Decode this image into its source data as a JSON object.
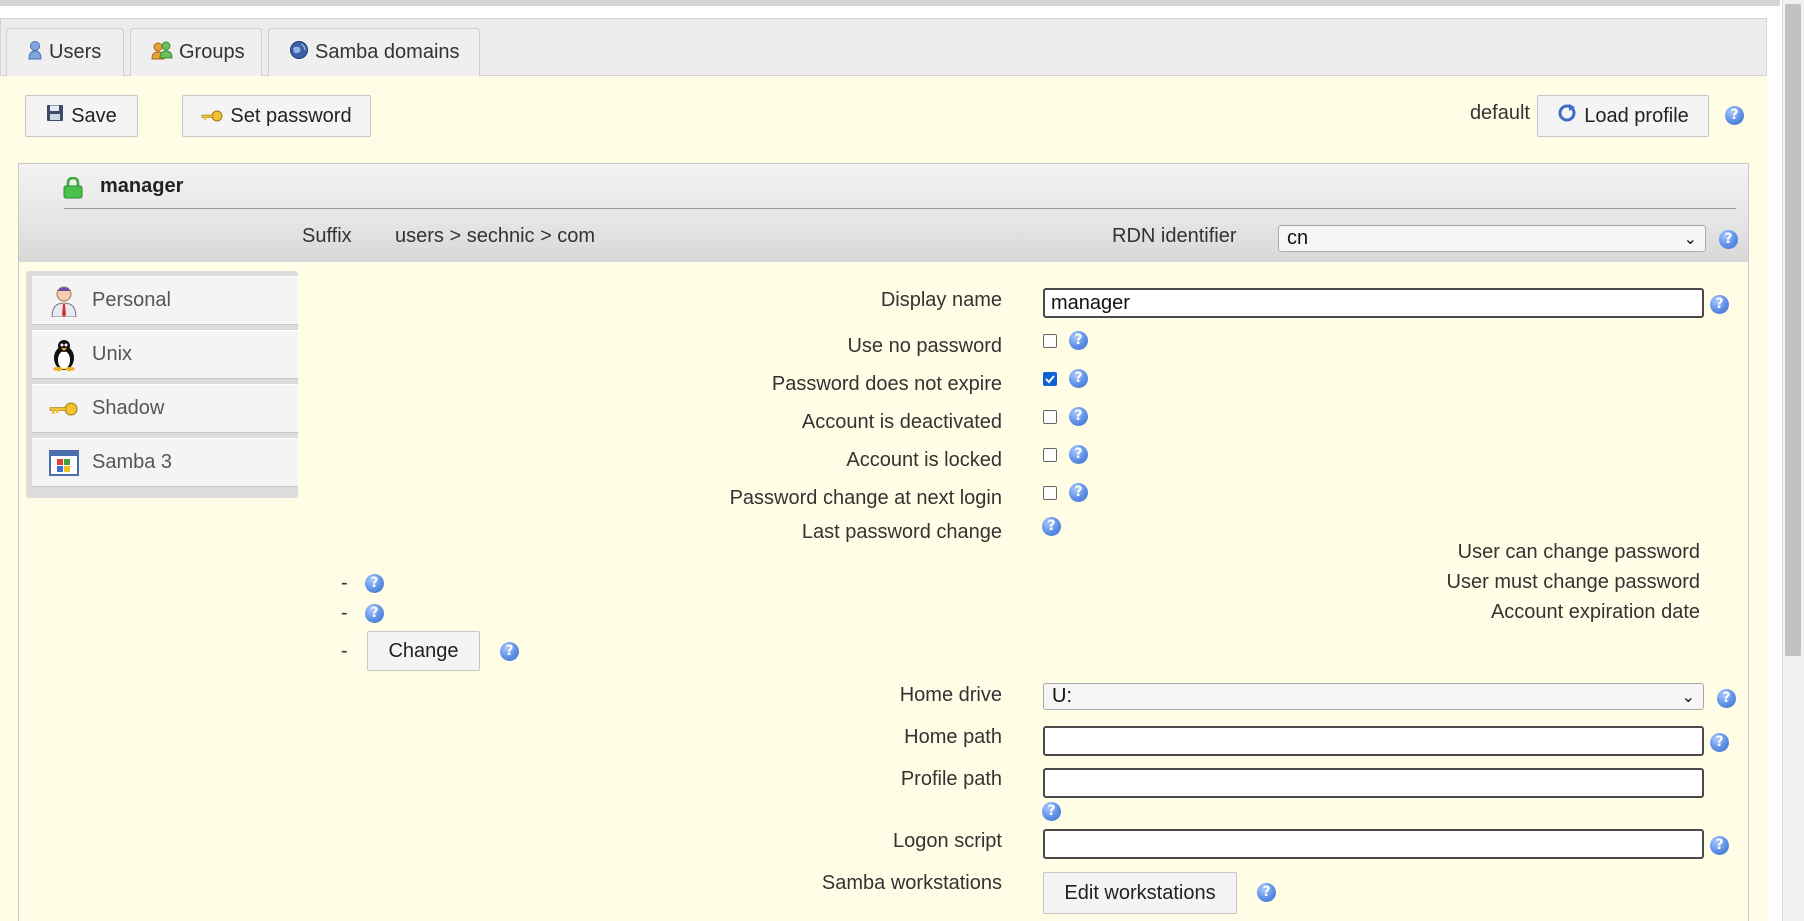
{
  "tabs": [
    {
      "label": "Users",
      "icon": "user-icon"
    },
    {
      "label": "Groups",
      "icon": "groups-icon"
    },
    {
      "label": "Samba domains",
      "icon": "globe-icon"
    }
  ],
  "toolbar": {
    "save_label": "Save",
    "set_password_label": "Set password",
    "profile_name": "default",
    "load_profile_label": "Load profile"
  },
  "header": {
    "title": "manager",
    "suffix_label": "Suffix",
    "suffix_value": "users > sechnic > com",
    "rdn_label": "RDN identifier",
    "rdn_value": "cn"
  },
  "modules": [
    {
      "label": "Personal",
      "icon": "personal-icon"
    },
    {
      "label": "Unix",
      "icon": "tux-icon"
    },
    {
      "label": "Shadow",
      "icon": "key-icon"
    },
    {
      "label": "Samba 3",
      "icon": "windows-icon"
    }
  ],
  "form": {
    "display_name_label": "Display name",
    "display_name_value": "manager",
    "use_no_password_label": "Use no password",
    "use_no_password_checked": false,
    "password_not_expire_label": "Password does not expire",
    "password_not_expire_checked": true,
    "account_deactivated_label": "Account is deactivated",
    "account_deactivated_checked": false,
    "account_locked_label": "Account is locked",
    "account_locked_checked": false,
    "password_change_next_label": "Password change at next login",
    "password_change_next_checked": false,
    "last_password_change_label": "Last password change",
    "user_can_change_label": "User can change password",
    "user_can_change_value": "-",
    "user_must_change_label": "User must change password",
    "user_must_change_value": "-",
    "account_expiration_label": "Account expiration date",
    "account_expiration_value": "-",
    "change_button_label": "Change",
    "home_drive_label": "Home drive",
    "home_drive_value": "U:",
    "home_path_label": "Home path",
    "home_path_value": "",
    "profile_path_label": "Profile path",
    "profile_path_value": "",
    "logon_script_label": "Logon script",
    "logon_script_value": "",
    "samba_workstations_label": "Samba workstations",
    "edit_workstations_label": "Edit workstations"
  },
  "help_glyph": "?",
  "chevron_glyph": "⌄"
}
